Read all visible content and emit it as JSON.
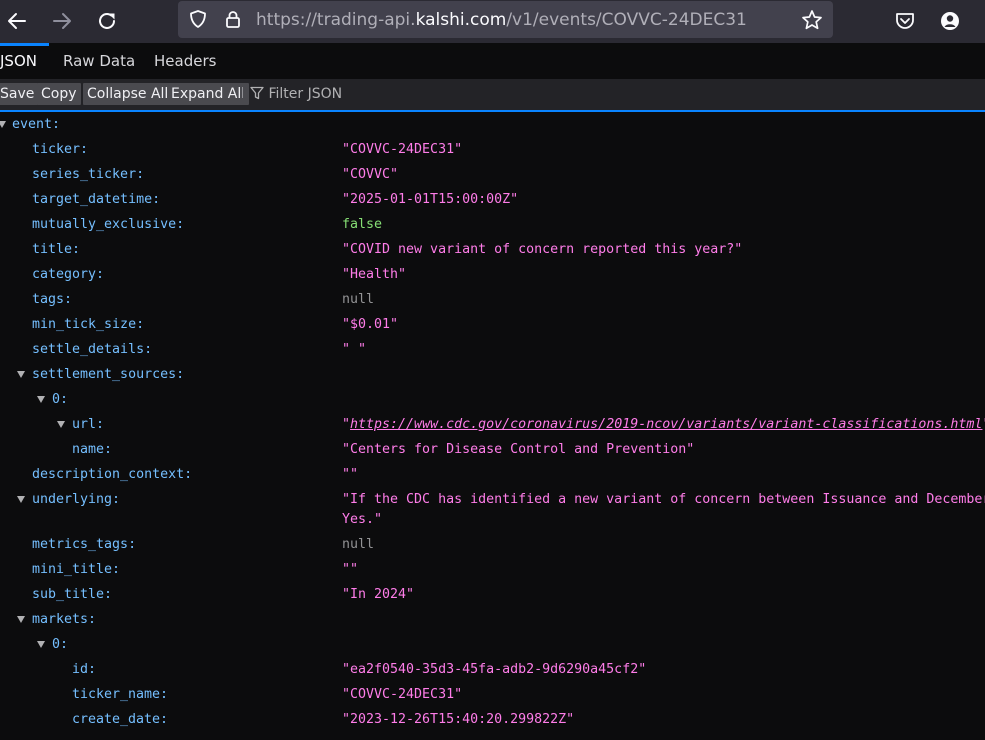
{
  "browser": {
    "url_prefix": "https://trading-api.",
    "url_domain": "kalshi.com",
    "url_path": "/v1/events/COVVC-24DEC31"
  },
  "viewer_tabs": [
    "JSON",
    "Raw Data",
    "Headers"
  ],
  "toolbar_buttons": [
    "Save",
    "Copy",
    "Collapse All",
    "Expand All"
  ],
  "filter_placeholder": "Filter JSON",
  "colors": {
    "key": "#75bfff",
    "string": "#ff7de9",
    "boolean": "#86de74",
    "null": "#939395",
    "accent": "#0a84ff"
  },
  "tree": {
    "root_key": "event:",
    "ticker": {
      "key": "ticker:",
      "value": "\"COVVC-24DEC31\""
    },
    "series_ticker": {
      "key": "series_ticker:",
      "value": "\"COVVC\""
    },
    "target_datetime": {
      "key": "target_datetime:",
      "value": "\"2025-01-01T15:00:00Z\""
    },
    "mutually_exclusive": {
      "key": "mutually_exclusive:",
      "value": "false"
    },
    "title": {
      "key": "title:",
      "value": "\"COVID new variant of concern reported this year?\""
    },
    "category": {
      "key": "category:",
      "value": "\"Health\""
    },
    "tags": {
      "key": "tags:",
      "value": "null"
    },
    "min_tick_size": {
      "key": "min_tick_size:",
      "value": "\"$0.01\""
    },
    "settle_details": {
      "key": "settle_details:",
      "value": "\" \""
    },
    "settlement_sources": {
      "key": "settlement_sources:"
    },
    "ss0": {
      "key": "0:"
    },
    "ss0_url": {
      "key": "url:",
      "value_open": "\"",
      "value_link": "https://www.cdc.gov/coronavirus/2019-ncov/variants/variant-classifications.html",
      "value_close": "\""
    },
    "ss0_name": {
      "key": "name:",
      "value": "\"Centers for Disease Control and Prevention\""
    },
    "description_context": {
      "key": "description_context:",
      "value": "\"\""
    },
    "underlying": {
      "key": "underlying:",
      "value_line1": "\"If the CDC has identified a new variant of concern between Issuance and December",
      "value_line2": "Yes.\""
    },
    "metrics_tags": {
      "key": "metrics_tags:",
      "value": "null"
    },
    "mini_title": {
      "key": "mini_title:",
      "value": "\"\""
    },
    "sub_title": {
      "key": "sub_title:",
      "value": "\"In 2024\""
    },
    "markets": {
      "key": "markets:"
    },
    "m0": {
      "key": "0:"
    },
    "m0_id": {
      "key": "id:",
      "value": "\"ea2f0540-35d3-45fa-adb2-9d6290a45cf2\""
    },
    "m0_ticker_name": {
      "key": "ticker_name:",
      "value": "\"COVVC-24DEC31\""
    },
    "m0_create_date": {
      "key": "create_date:",
      "value": "\"2023-12-26T15:40:20.299822Z\""
    }
  }
}
